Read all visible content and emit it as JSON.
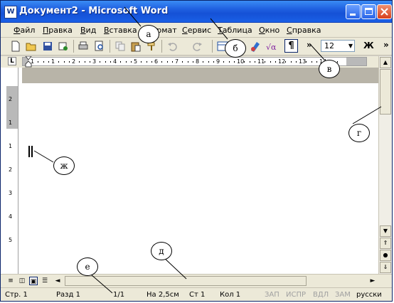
{
  "window": {
    "title": "Документ2 - Microsoft Word",
    "icon_letter": "W"
  },
  "menu": [
    "Файл",
    "Правка",
    "Вид",
    "Вставка",
    "Формат",
    "Сервис",
    "Таблица",
    "Окно",
    "Справка"
  ],
  "toolbar": {
    "pilcrow": "¶",
    "more": "»",
    "font_size": "12",
    "bold": "Ж"
  },
  "ruler": {
    "tab_type": "L",
    "h_numbers": [
      "1",
      "1",
      "2",
      "3",
      "4",
      "5",
      "6",
      "7",
      "8",
      "9",
      "10",
      "11",
      "12",
      "13",
      "14"
    ],
    "v_numbers": [
      "2",
      "1",
      "1",
      "2",
      "3",
      "4",
      "5"
    ]
  },
  "status": {
    "page": "Стр. 1",
    "section": "Разд 1",
    "page_of": "1/1",
    "at": "На 2,5см",
    "line": "Ст 1",
    "col": "Кол 1",
    "rec": "ЗАП",
    "trk": "ИСПР",
    "ext": "ВДЛ",
    "ovr": "ЗАМ",
    "lang": "русски"
  },
  "callouts": {
    "a": "а",
    "b": "б",
    "v": "в",
    "g": "г",
    "d": "д",
    "e": "е",
    "zh": "ж"
  }
}
